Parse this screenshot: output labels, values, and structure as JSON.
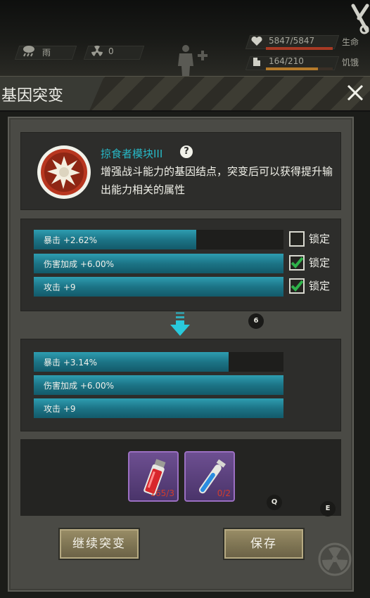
{
  "hud": {
    "weather_label": "雨",
    "radiation_value": "0",
    "life_value": "5847/5847",
    "life_label": "生命",
    "life_fraction": 1.0,
    "hunger_value": "164/210",
    "hunger_label": "饥饿",
    "hunger_fraction": 0.78,
    "icons": [
      "rain-cloud-icon",
      "radiation-icon",
      "body-silhouette-icon",
      "heart-icon",
      "stomach-icon",
      "crossed-tools-icon"
    ]
  },
  "dialog": {
    "title": "基因突变",
    "close_icon": "close-icon"
  },
  "module": {
    "name": "掠食者模块III",
    "help_symbol": "?",
    "description": "增强战斗能力的基因结点，突变后可以获得提升输出能力相关的属性",
    "icon": "predator-module-icon"
  },
  "current_stats": [
    {
      "label": "暴击 +2.62%",
      "fill": 0.65,
      "locked": false,
      "lock_label": "锁定"
    },
    {
      "label": "伤害加成 +6.00%",
      "fill": 1.0,
      "locked": true,
      "lock_label": "锁定"
    },
    {
      "label": "攻击 +9",
      "fill": 1.0,
      "locked": true,
      "lock_label": "锁定"
    }
  ],
  "result_stats": [
    {
      "label": "暴击 +3.14%",
      "fill": 0.78
    },
    {
      "label": "伤害加成 +6.00%",
      "fill": 1.0
    },
    {
      "label": "攻击 +9",
      "fill": 1.0
    }
  ],
  "badges": {
    "b1": "6",
    "b2": "Q",
    "b3": "E"
  },
  "materials": [
    {
      "name": "red-serum-vial",
      "count": "165/3",
      "color": "#d8262c"
    },
    {
      "name": "blue-serum-tube",
      "count": "0/2",
      "color": "#2a8ce0"
    }
  ],
  "buttons": {
    "continue_label": "继续突变",
    "save_label": "保存"
  },
  "colors": {
    "accent_cyan": "#27b8c6",
    "stat_bar": "#1c7486",
    "button_gold": "#8a7f5c",
    "item_purple": "#6d4f91"
  }
}
